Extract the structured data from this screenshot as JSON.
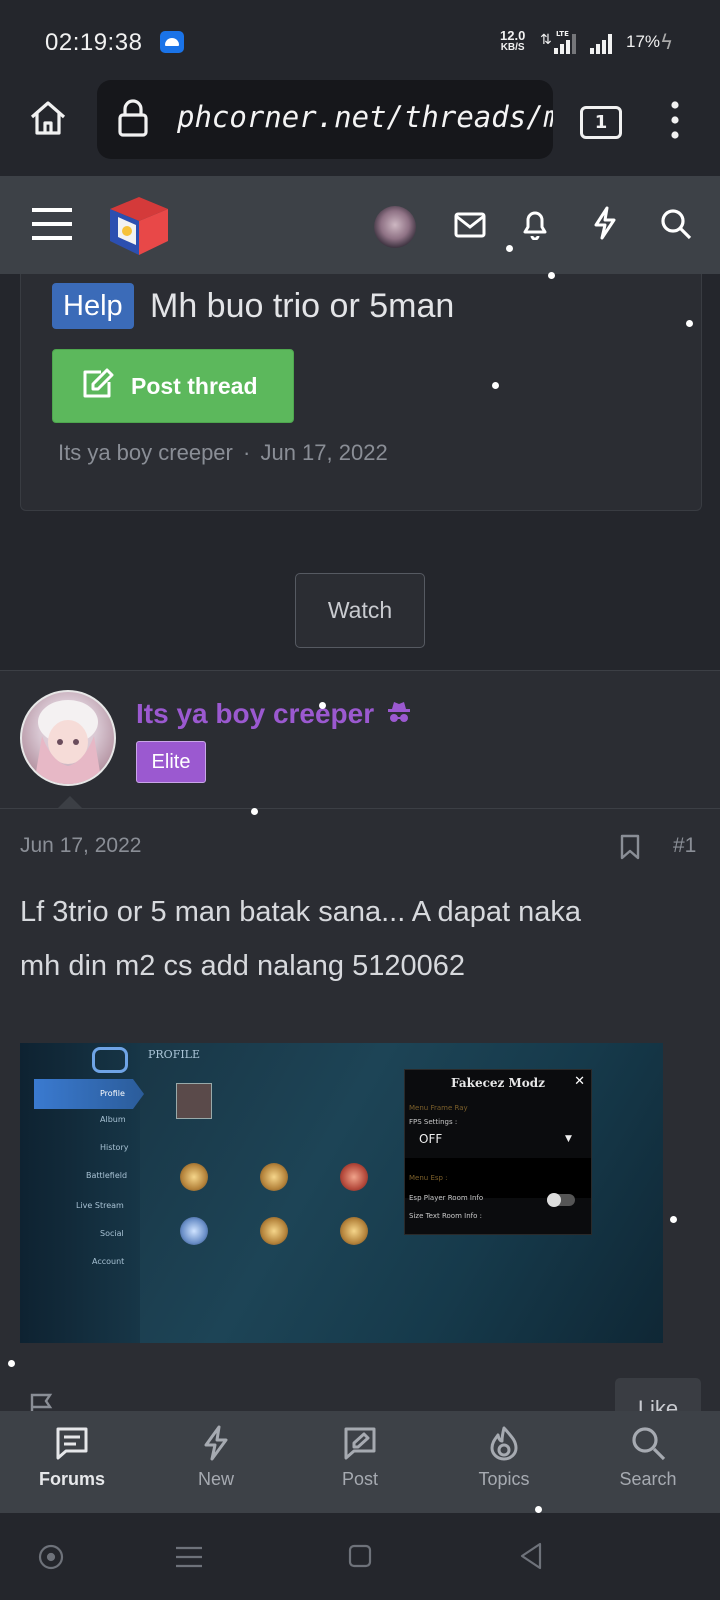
{
  "status_bar": {
    "time": "02:19:38",
    "net_speed_value": "12.0",
    "net_speed_unit": "KB/S",
    "network_type": "LTE",
    "battery": "17%",
    "icons": [
      "android-notification-icon",
      "data-arrows-icon",
      "signal-icon",
      "signal-icon",
      "charging-icon"
    ]
  },
  "browser": {
    "url": "phcorner.net/threads/mh-bu",
    "tab_count": "1",
    "icons": [
      "home-icon",
      "lock-icon",
      "more-icon"
    ]
  },
  "forum_header": {
    "icons": [
      "menu-icon",
      "site-logo",
      "user-avatar",
      "inbox-icon",
      "bell-icon",
      "lightning-icon",
      "search-icon"
    ]
  },
  "thread": {
    "prefix": "Help",
    "title": "Mh buo trio or 5man",
    "post_thread_label": "Post thread",
    "author": "Its ya boy creeper",
    "separator": "·",
    "date": "Jun 17, 2022",
    "watch_label": "Watch"
  },
  "post": {
    "username": "Its ya boy creeper",
    "user_title": "Elite",
    "date": "Jun 17, 2022",
    "number": "#1",
    "body_line1": "Lf 3trio or 5 man batak sana... A dapat naka",
    "body_line2": "mh din m2 cs add nalang 5120062",
    "like_label": "Like",
    "image": {
      "profile_label": "PROFILE",
      "side_items": [
        "Profile",
        "Album",
        "History",
        "Battlefield",
        "Live Stream",
        "Social",
        "Account"
      ],
      "panel_title": "Fakecez Modz",
      "panel_section1": "Menu Frame Ray",
      "panel_fps_label": "FPS Settings :",
      "panel_fps_value": "OFF",
      "panel_section2": "Menu Esp :",
      "panel_option1": "Esp Player Room Info",
      "panel_option2": "Size Text Room Info :"
    }
  },
  "bottom_nav": [
    {
      "label": "Forums",
      "icon": "forums-icon",
      "active": true
    },
    {
      "label": "New",
      "icon": "lightning-icon",
      "active": false
    },
    {
      "label": "Post",
      "icon": "post-icon",
      "active": false
    },
    {
      "label": "Topics",
      "icon": "flame-icon",
      "active": false
    },
    {
      "label": "Search",
      "icon": "search-icon",
      "active": false
    }
  ],
  "system_nav": {
    "icons": [
      "assistant-icon",
      "recents-icon",
      "home-square-icon",
      "back-icon"
    ]
  },
  "colors": {
    "background": "#24262c",
    "header": "#3d4147",
    "help_badge": "#3b6bb8",
    "post_button": "#5cb85c",
    "username": "#9b59d0"
  }
}
